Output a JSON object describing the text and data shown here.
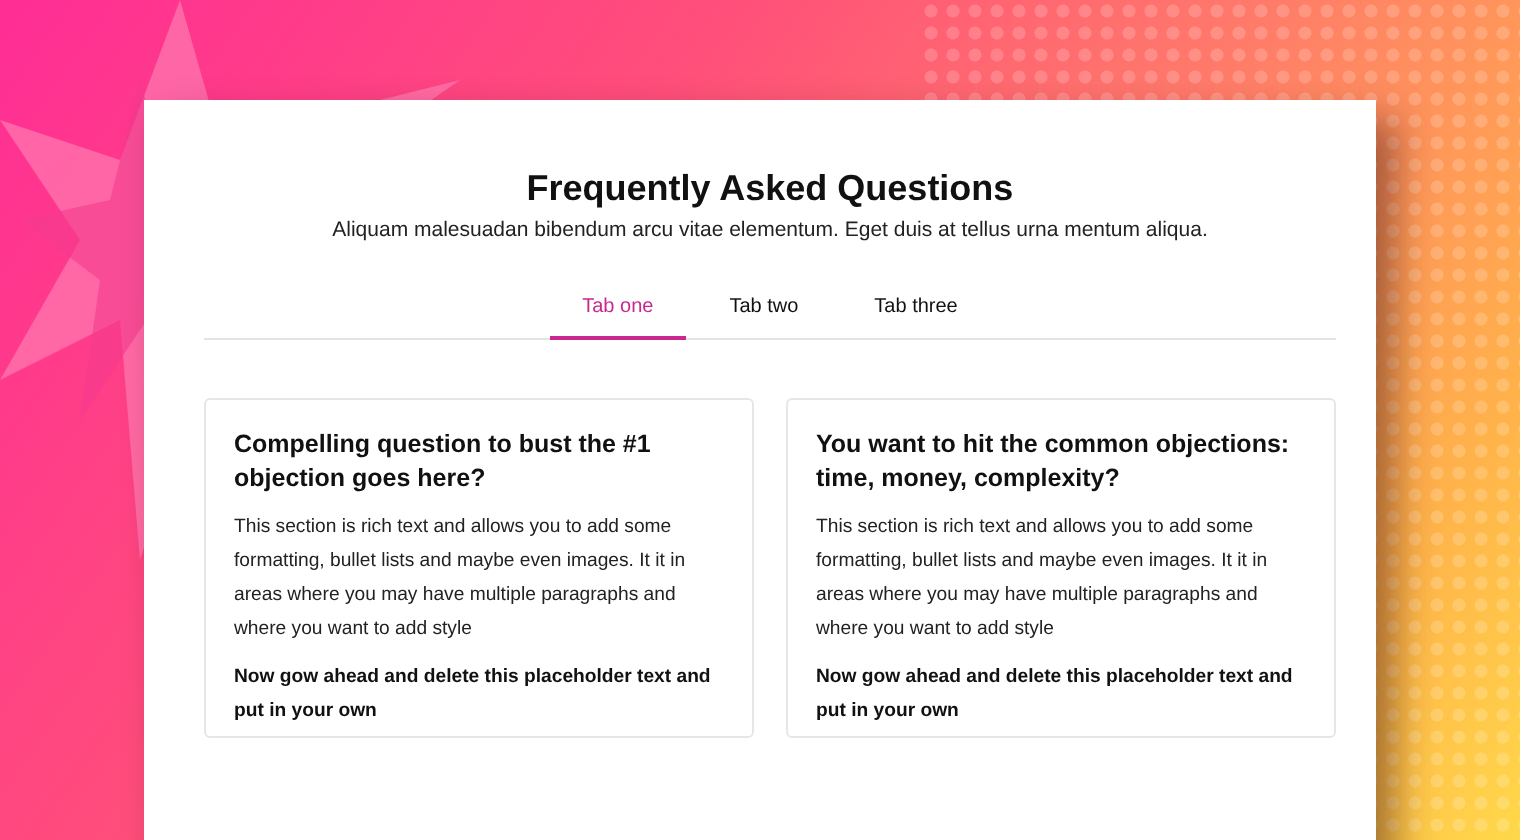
{
  "header": {
    "title": "Frequently Asked Questions",
    "subtitle": "Aliquam malesuadan bibendum arcu vitae elementum. Eget duis at tellus urna mentum aliqua."
  },
  "tabs": [
    {
      "label": "Tab one",
      "selected": true
    },
    {
      "label": "Tab two",
      "selected": false
    },
    {
      "label": "Tab three",
      "selected": false
    }
  ],
  "faqs": [
    {
      "question": "Compelling question to bust the #1 objection goes here?",
      "body": "This section is rich text and allows you to add some formatting, bullet lists and maybe even images. It it in areas where you may have multiple paragraphs and where you want to add style",
      "note": "Now gow ahead and delete this placeholder text and put in your own"
    },
    {
      "question": "You want to hit the common objections: time, money, complexity?",
      "body": "This section is rich text and allows you to add some formatting, bullet lists and maybe even images. It it in areas where you may have multiple paragraphs and where you want to add style",
      "note": "Now gow ahead and delete this placeholder text and put in your own"
    }
  ]
}
